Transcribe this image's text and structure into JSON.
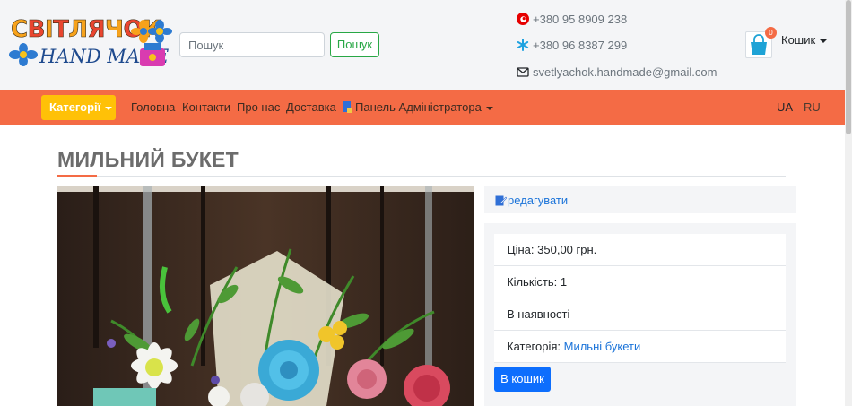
{
  "header": {
    "logo": {
      "word_top_letters": [
        {
          "ch": "С",
          "color": "#f7a21b"
        },
        {
          "ch": "В",
          "color": "#e9452f"
        },
        {
          "ch": "І",
          "color": "#f7a21b"
        },
        {
          "ch": "Т",
          "color": "#e9452f"
        },
        {
          "ch": "Л",
          "color": "#f7a21b"
        },
        {
          "ch": "Я",
          "color": "#e9452f"
        },
        {
          "ch": "Ч",
          "color": "#f7a21b"
        },
        {
          "ch": "О",
          "color": "#e9452f"
        },
        {
          "ch": "К",
          "color": "#f7a21b"
        }
      ],
      "word_bottom": "HAND MADE"
    },
    "search": {
      "placeholder": "Пошук",
      "button_label": "Пошук"
    },
    "contacts": [
      {
        "icon": "vodafone-icon",
        "text": "+380 95 8909 238"
      },
      {
        "icon": "kyivstar-icon",
        "text": "+380 96 8387 299"
      },
      {
        "icon": "envelope-icon",
        "text": "svetlyachok.handmade@gmail.com"
      }
    ],
    "cart": {
      "icon": "shopping-bag-icon",
      "count": "0",
      "label": "Кошик"
    }
  },
  "navbar": {
    "categories_label": "Категорії",
    "links": [
      "Головна",
      "Контакти",
      "Про нас",
      "Доставка"
    ],
    "admin_label": "Панель Адміністратора",
    "languages": [
      "UA",
      "RU"
    ]
  },
  "product": {
    "title": "МИЛЬНИЙ БУКЕТ",
    "edit_label": "редагувати",
    "price": "Ціна: 350,00 грн.",
    "quantity": "Кількість: 1",
    "availability": "В наявності",
    "category_prefix": "Категорія: ",
    "category_link": "Мильні букети",
    "add_to_cart": "В кошик"
  },
  "colors": {
    "navbar": "#f46b45",
    "categories_button": "#ffc107",
    "primary": "#0d6efd",
    "link": "#1a73d9",
    "search_button": "#28a745"
  }
}
